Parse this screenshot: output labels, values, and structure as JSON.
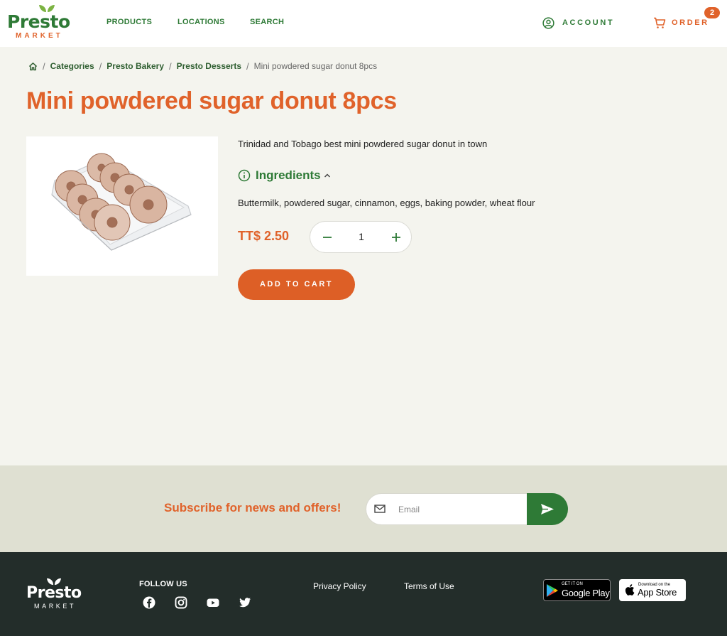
{
  "header": {
    "logo_text": "Presto",
    "logo_sub": "MARKET",
    "nav": [
      {
        "label": "PRODUCTS"
      },
      {
        "label": "LOCATIONS"
      },
      {
        "label": "SEARCH"
      }
    ],
    "account_label": "ACCOUNT",
    "order_label": "ORDER",
    "order_count": "2"
  },
  "breadcrumb": {
    "items": [
      "Categories",
      "Presto Bakery",
      "Presto Desserts"
    ],
    "current": "Mini powdered sugar donut 8pcs"
  },
  "product": {
    "title": "Mini powdered sugar donut 8pcs",
    "description": "Trinidad and Tobago best mini powdered sugar donut in town",
    "ingredients_heading": "Ingredients",
    "ingredients": "Buttermilk, powdered sugar, cinnamon, eggs, baking powder, wheat flour",
    "price": "TT$ 2.50",
    "quantity": "1",
    "add_to_cart_label": "ADD TO CART"
  },
  "subscribe": {
    "label": "Subscribe for news and offers!",
    "email_placeholder": "Email"
  },
  "footer": {
    "logo_text": "Presto",
    "logo_sub": "MARKET",
    "follow_label": "FOLLOW US",
    "social": [
      "facebook-icon",
      "instagram-icon",
      "youtube-icon",
      "twitter-icon"
    ],
    "links": [
      "Privacy Policy",
      "Terms of Use"
    ],
    "google_play_small": "GET IT ON",
    "google_play_big": "Google Play",
    "app_store_small": "Download on the",
    "app_store_big": "App Store"
  },
  "colors": {
    "brand_green": "#2e7a36",
    "brand_orange": "#e0622a",
    "page_bg": "#f4f4ee",
    "footer_bg": "#232d2a"
  }
}
